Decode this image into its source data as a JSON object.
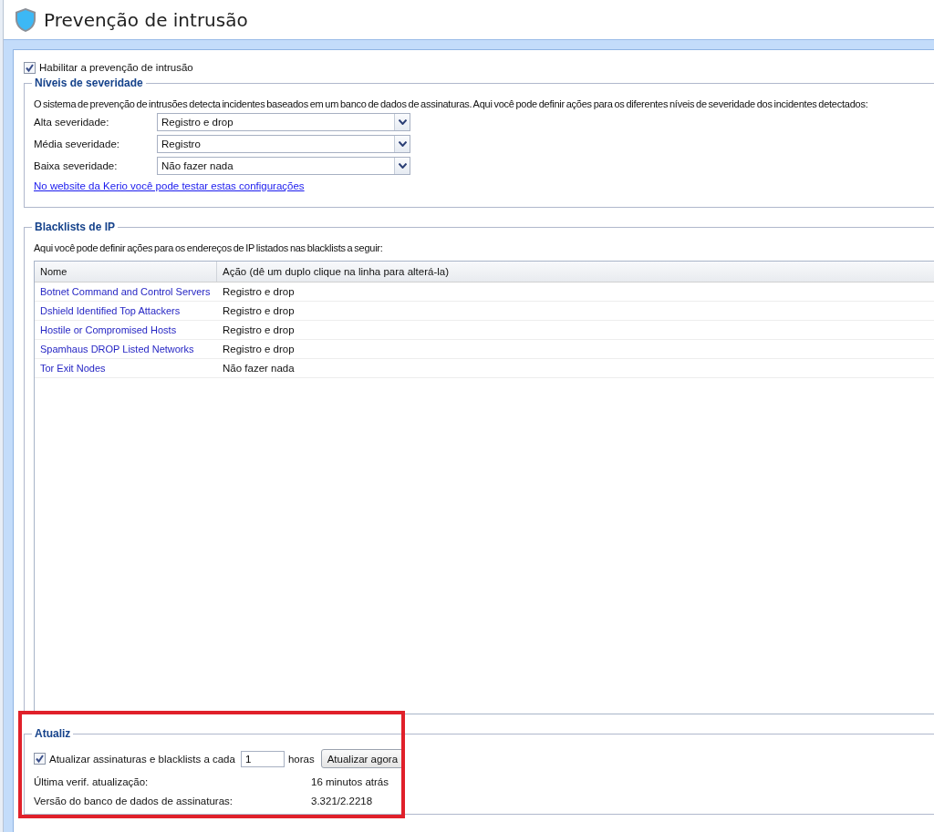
{
  "title": "Prevenção de intrusão",
  "enable": {
    "label": "Habilitar a prevenção de intrusão",
    "checked": true
  },
  "severity": {
    "legend": "Níveis de severidade",
    "description": "O sistema de prevenção de intrusões detecta incidentes baseados em um banco de dados de assinaturas. Aqui você pode definir ações para os diferentes níveis de severidade dos incidentes detectados:",
    "levels": [
      {
        "label": "Alta severidade:",
        "value": "Registro e drop"
      },
      {
        "label": "Média severidade:",
        "value": "Registro"
      },
      {
        "label": "Baixa severidade:",
        "value": "Não fazer nada"
      }
    ],
    "link": "No website da Kerio você pode testar estas configurações"
  },
  "blacklists": {
    "legend": "Blacklists de IP",
    "description": "Aqui você pode definir ações para os endereços de IP listados nas blacklists a seguir:",
    "columns": [
      "Nome",
      "Ação (dê um duplo clique na linha para alterá-la)"
    ],
    "rows": [
      {
        "name": "Botnet Command and Control Servers",
        "action": "Registro e drop"
      },
      {
        "name": "Dshield Identified Top Attackers",
        "action": "Registro e drop"
      },
      {
        "name": "Hostile or Compromised Hosts",
        "action": "Registro e drop"
      },
      {
        "name": "Spamhaus DROP Listed Networks",
        "action": "Registro e drop"
      },
      {
        "name": "Tor Exit Nodes",
        "action": "Não fazer nada"
      }
    ]
  },
  "update": {
    "legend": "Atualiz",
    "auto": {
      "label": "Atualizar assinaturas e blacklists a cada",
      "checked": true
    },
    "interval": "1",
    "unit": "horas",
    "button": "Atualizar agora",
    "info": [
      {
        "label": "Última verif. atualização:",
        "value": "16 minutos atrás"
      },
      {
        "label": "Versão do banco de dados de assinaturas:",
        "value": "3.321/2.2218"
      }
    ]
  }
}
